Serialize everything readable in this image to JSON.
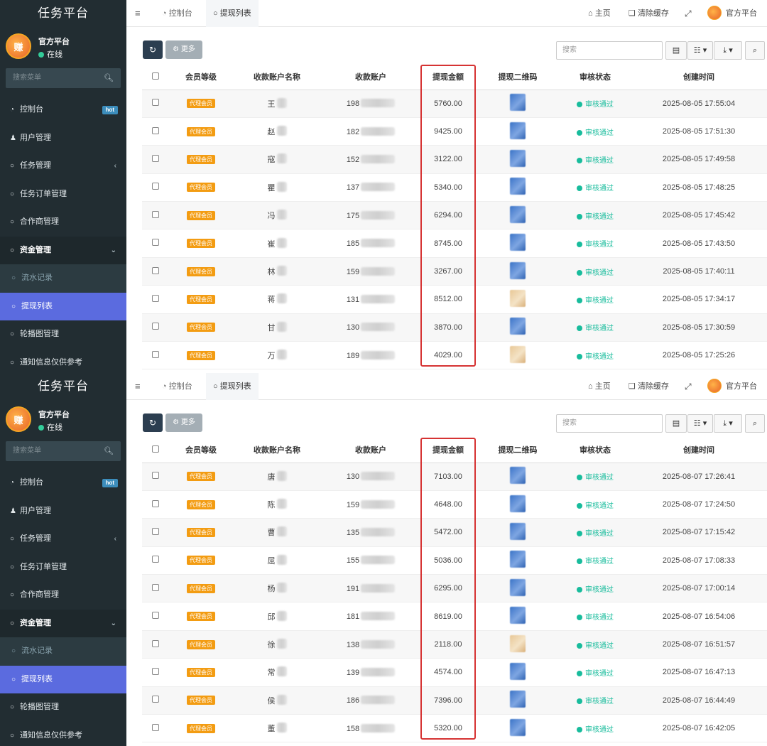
{
  "sidebar": {
    "brand": "任务平台",
    "avatar_text": "赚",
    "user_name": "官方平台",
    "user_status": "在线",
    "search_placeholder": "搜索菜单",
    "items": [
      {
        "label": "控制台",
        "icon": "dashboard-icon",
        "badge": "hot"
      },
      {
        "label": "用户管理",
        "icon": "user-icon"
      },
      {
        "label": "任务管理",
        "icon": "circle-icon",
        "caret": "‹"
      },
      {
        "label": "任务订单管理",
        "icon": "circle-icon"
      },
      {
        "label": "合作商管理",
        "icon": "circle-icon"
      },
      {
        "label": "资金管理",
        "icon": "circle-icon",
        "caret": "⌄"
      },
      {
        "label": "流水记录",
        "icon": "circle-icon"
      },
      {
        "label": "提现列表",
        "icon": "circle-icon"
      },
      {
        "label": "轮播图管理",
        "icon": "circle-icon"
      },
      {
        "label": "通知信息仅供参考",
        "icon": "circle-icon"
      }
    ]
  },
  "topbar": {
    "tab_dashboard": "控制台",
    "tab_withdraw": "提现列表",
    "home": "主页",
    "clear_cache": "清除缓存",
    "admin": "官方平台"
  },
  "toolbar": {
    "more": "更多",
    "search_placeholder": "搜索"
  },
  "table": {
    "headers": [
      "会员等级",
      "收款账户名称",
      "收款账户",
      "提现金额",
      "提现二维码",
      "审核状态",
      "创建时间"
    ],
    "level_label": "代理会员",
    "status_label": "审核通过"
  },
  "panel1": {
    "rows": [
      {
        "name": "王",
        "account": "198",
        "amount": "5760.00",
        "qr": "blue",
        "time": "2025-08-05 17:55:04"
      },
      {
        "name": "赵",
        "account": "182",
        "amount": "9425.00",
        "qr": "blue",
        "time": "2025-08-05 17:51:30"
      },
      {
        "name": "寇",
        "account": "152",
        "amount": "3122.00",
        "qr": "blue",
        "time": "2025-08-05 17:49:58"
      },
      {
        "name": "瞿",
        "account": "137",
        "amount": "5340.00",
        "qr": "blue",
        "time": "2025-08-05 17:48:25"
      },
      {
        "name": "冯",
        "account": "175",
        "amount": "6294.00",
        "qr": "blue",
        "time": "2025-08-05 17:45:42"
      },
      {
        "name": "崔",
        "account": "185",
        "amount": "8745.00",
        "qr": "blue",
        "time": "2025-08-05 17:43:50"
      },
      {
        "name": "林",
        "account": "159",
        "amount": "3267.00",
        "qr": "blue",
        "time": "2025-08-05 17:40:11"
      },
      {
        "name": "蒋",
        "account": "131",
        "amount": "8512.00",
        "qr": "tan",
        "time": "2025-08-05 17:34:17"
      },
      {
        "name": "甘",
        "account": "130",
        "amount": "3870.00",
        "qr": "blue",
        "time": "2025-08-05 17:30:59"
      },
      {
        "name": "万",
        "account": "189",
        "amount": "4029.00",
        "qr": "tan",
        "time": "2025-08-05 17:25:26"
      }
    ]
  },
  "panel2": {
    "rows": [
      {
        "name": "唐",
        "account": "130",
        "amount": "7103.00",
        "qr": "blue",
        "time": "2025-08-07 17:26:41"
      },
      {
        "name": "陈",
        "account": "159",
        "amount": "4648.00",
        "qr": "blue",
        "time": "2025-08-07 17:24:50"
      },
      {
        "name": "曹",
        "account": "135",
        "amount": "5472.00",
        "qr": "blue",
        "time": "2025-08-07 17:15:42"
      },
      {
        "name": "屈",
        "account": "155",
        "amount": "5036.00",
        "qr": "blue",
        "time": "2025-08-07 17:08:33"
      },
      {
        "name": "杨",
        "account": "191",
        "amount": "6295.00",
        "qr": "blue",
        "time": "2025-08-07 17:00:14"
      },
      {
        "name": "邱",
        "account": "181",
        "amount": "8619.00",
        "qr": "blue",
        "time": "2025-08-07 16:54:06"
      },
      {
        "name": "徐",
        "account": "138",
        "amount": "2118.00",
        "qr": "tan",
        "time": "2025-08-07 16:51:57"
      },
      {
        "name": "常",
        "account": "139",
        "amount": "4574.00",
        "qr": "blue",
        "time": "2025-08-07 16:47:13"
      },
      {
        "name": "侯",
        "account": "186",
        "amount": "7396.00",
        "qr": "blue",
        "time": "2025-08-07 16:44:49"
      },
      {
        "name": "董",
        "account": "158",
        "amount": "5320.00",
        "qr": "blue",
        "time": "2025-08-07 16:42:05"
      }
    ]
  },
  "colors": {
    "sidebar_bg": "#222d32",
    "active_menu": "#5b6bdf",
    "level_badge": "#f39c12",
    "status_green": "#18bc9c",
    "highlight_red": "#d63333"
  }
}
